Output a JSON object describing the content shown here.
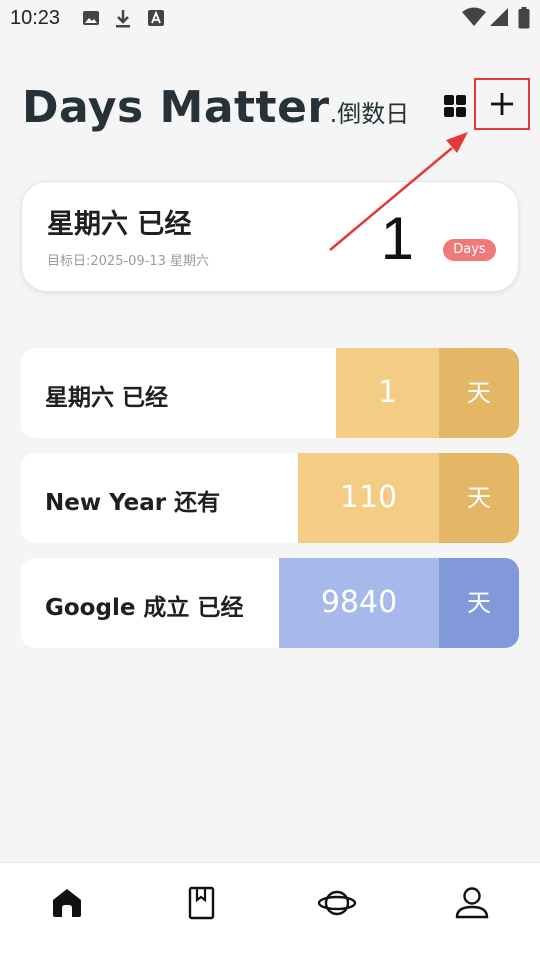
{
  "status_bar": {
    "time": "10:23",
    "icons": [
      "image-icon",
      "download-icon",
      "font-icon"
    ],
    "right_icons": [
      "wifi-icon",
      "signal-icon",
      "battery-icon"
    ]
  },
  "header": {
    "title": "Days Matter",
    "subtitle": ".倒数日",
    "grid_icon": "grid-icon",
    "add_icon": "plus-icon"
  },
  "highlight_card": {
    "title": "星期六 已经",
    "target_date": "目标日:2025-09-13 星期六",
    "count": "1",
    "badge": "Days"
  },
  "events": [
    {
      "label": "星期六 已经",
      "count": "1",
      "unit": "天",
      "color": "#f4cd84"
    },
    {
      "label": "New Year 还有",
      "count": "110",
      "unit": "天",
      "color": "#f4cd84"
    },
    {
      "label": "Google 成立 已经",
      "count": "9840",
      "unit": "天",
      "color": "#a7b9ea"
    }
  ],
  "bottom_nav": [
    "home-icon",
    "book-icon",
    "planet-icon",
    "profile-icon"
  ],
  "colors": {
    "accent_red": "#e53935",
    "badge": "#ef7a7a",
    "yellow": "#f4cd84",
    "yellow_dark": "#e3b765",
    "blue": "#a7b9ea",
    "blue_dark": "#8199d8"
  }
}
